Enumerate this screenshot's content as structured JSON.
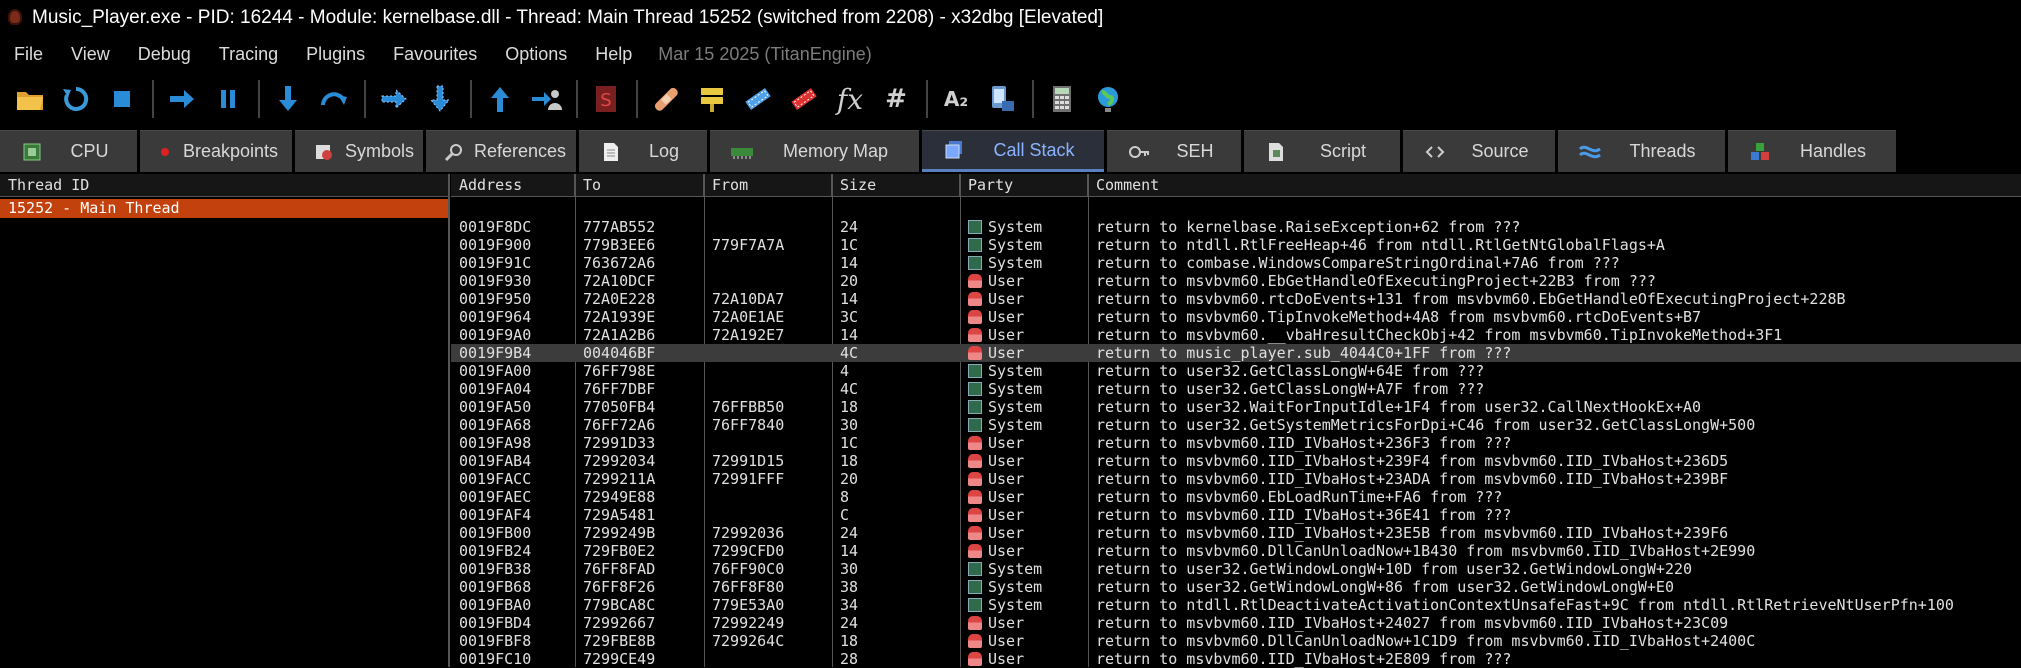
{
  "window": {
    "title": "Music_Player.exe - PID: 16244 - Module: kernelbase.dll - Thread: Main Thread 15252 (switched from 2208) - x32dbg [Elevated]"
  },
  "menu": {
    "items": [
      "File",
      "View",
      "Debug",
      "Tracing",
      "Plugins",
      "Favourites",
      "Options",
      "Help"
    ],
    "date_label": "Mar 15 2025 (TitanEngine)"
  },
  "toolbar": {
    "icons": [
      "open-icon",
      "restart-icon",
      "stop-icon",
      "run-icon",
      "pause-icon",
      "step-into-icon",
      "step-over-icon",
      "trace-into-icon",
      "trace-over-icon",
      "execute-till-return-icon",
      "run-to-user-code-icon",
      "scylla-icon",
      "patch-icon",
      "comments-icon",
      "labels-icon",
      "bookmarks-icon",
      "functions-icon",
      "variables-icon",
      "strings-icon",
      "device-icon",
      "calculator-icon",
      "globe-icon"
    ],
    "fx_label": "fx",
    "hash_label": "#",
    "a2_label": "A₂"
  },
  "tabs": [
    {
      "label": "CPU",
      "icon": "cpu-icon",
      "active": false
    },
    {
      "label": "Breakpoints",
      "icon": "breakpoint-dot-icon",
      "active": false
    },
    {
      "label": "Symbols",
      "icon": "symbols-icon",
      "active": false
    },
    {
      "label": "References",
      "icon": "magnifier-icon",
      "active": false
    },
    {
      "label": "Log",
      "icon": "log-icon",
      "active": false
    },
    {
      "label": "Memory Map",
      "icon": "memory-map-icon",
      "active": false
    },
    {
      "label": "Call Stack",
      "icon": "call-stack-icon",
      "active": true
    },
    {
      "label": "SEH",
      "icon": "seh-icon",
      "active": false
    },
    {
      "label": "Script",
      "icon": "script-icon",
      "active": false
    },
    {
      "label": "Source",
      "icon": "source-icon",
      "active": false
    },
    {
      "label": "Threads",
      "icon": "threads-icon",
      "active": false
    },
    {
      "label": "Handles",
      "icon": "handles-icon",
      "active": false
    }
  ],
  "threads_pane": {
    "header": "Thread ID",
    "items": [
      "15252 - Main Thread"
    ]
  },
  "callstack": {
    "headers": {
      "address": "Address",
      "to": "To",
      "from": "From",
      "size": "Size",
      "party": "Party",
      "comment": "Comment"
    },
    "rows": [
      {
        "address": "0019F8DC",
        "to": "777AB552",
        "from": "",
        "size": "24",
        "party": "System",
        "comment": "return to kernelbase.RaiseException+62 from ???"
      },
      {
        "address": "0019F900",
        "to": "779B3EE6",
        "from": "779F7A7A",
        "size": "1C",
        "party": "System",
        "comment": "return to ntdll.RtlFreeHeap+46 from ntdll.RtlGetNtGlobalFlags+A"
      },
      {
        "address": "0019F91C",
        "to": "763672A6",
        "from": "",
        "size": "14",
        "party": "System",
        "comment": "return to combase.WindowsCompareStringOrdinal+7A6 from ???"
      },
      {
        "address": "0019F930",
        "to": "72A10DCF",
        "from": "",
        "size": "20",
        "party": "User",
        "comment": "return to msvbvm60.EbGetHandleOfExecutingProject+22B3 from ???"
      },
      {
        "address": "0019F950",
        "to": "72A0E228",
        "from": "72A10DA7",
        "size": "14",
        "party": "User",
        "comment": "return to msvbvm60.rtcDoEvents+131 from msvbvm60.EbGetHandleOfExecutingProject+228B"
      },
      {
        "address": "0019F964",
        "to": "72A1939E",
        "from": "72A0E1AE",
        "size": "3C",
        "party": "User",
        "comment": "return to msvbvm60.TipInvokeMethod+4A8 from msvbvm60.rtcDoEvents+B7"
      },
      {
        "address": "0019F9A0",
        "to": "72A1A2B6",
        "from": "72A192E7",
        "size": "14",
        "party": "User",
        "comment": "return to msvbvm60.__vbaHresultCheckObj+42 from msvbvm60.TipInvokeMethod+3F1"
      },
      {
        "address": "0019F9B4",
        "to": "004046BF",
        "from": "",
        "size": "4C",
        "party": "User",
        "comment": "return to music_player.sub_4044C0+1FF from ???",
        "selected": true
      },
      {
        "address": "0019FA00",
        "to": "76FF798E",
        "from": "",
        "size": "4",
        "party": "System",
        "comment": "return to user32.GetClassLongW+64E from ???"
      },
      {
        "address": "0019FA04",
        "to": "76FF7DBF",
        "from": "",
        "size": "4C",
        "party": "System",
        "comment": "return to user32.GetClassLongW+A7F from ???"
      },
      {
        "address": "0019FA50",
        "to": "77050FB4",
        "from": "76FFBB50",
        "size": "18",
        "party": "System",
        "comment": "return to user32.WaitForInputIdle+1F4 from user32.CallNextHookEx+A0"
      },
      {
        "address": "0019FA68",
        "to": "76FF72A6",
        "from": "76FF7840",
        "size": "30",
        "party": "System",
        "comment": "return to user32.GetSystemMetricsForDpi+C46 from user32.GetClassLongW+500"
      },
      {
        "address": "0019FA98",
        "to": "72991D33",
        "from": "",
        "size": "1C",
        "party": "User",
        "comment": "return to msvbvm60.IID_IVbaHost+236F3 from ???"
      },
      {
        "address": "0019FAB4",
        "to": "72992034",
        "from": "72991D15",
        "size": "18",
        "party": "User",
        "comment": "return to msvbvm60.IID_IVbaHost+239F4 from msvbvm60.IID_IVbaHost+236D5"
      },
      {
        "address": "0019FACC",
        "to": "7299211A",
        "from": "72991FFF",
        "size": "20",
        "party": "User",
        "comment": "return to msvbvm60.IID_IVbaHost+23ADA from msvbvm60.IID_IVbaHost+239BF"
      },
      {
        "address": "0019FAEC",
        "to": "72949E88",
        "from": "",
        "size": "8",
        "party": "User",
        "comment": "return to msvbvm60.EbLoadRunTime+FA6 from ???"
      },
      {
        "address": "0019FAF4",
        "to": "729A5481",
        "from": "",
        "size": "C",
        "party": "User",
        "comment": "return to msvbvm60.IID_IVbaHost+36E41 from ???"
      },
      {
        "address": "0019FB00",
        "to": "7299249B",
        "from": "72992036",
        "size": "24",
        "party": "User",
        "comment": "return to msvbvm60.IID_IVbaHost+23E5B from msvbvm60.IID_IVbaHost+239F6"
      },
      {
        "address": "0019FB24",
        "to": "729FB0E2",
        "from": "7299CFD0",
        "size": "14",
        "party": "User",
        "comment": "return to msvbvm60.DllCanUnloadNow+1B430 from msvbvm60.IID_IVbaHost+2E990"
      },
      {
        "address": "0019FB38",
        "to": "76FF8FAD",
        "from": "76FF90C0",
        "size": "30",
        "party": "System",
        "comment": "return to user32.GetWindowLongW+10D from user32.GetWindowLongW+220"
      },
      {
        "address": "0019FB68",
        "to": "76FF8F26",
        "from": "76FF8F80",
        "size": "38",
        "party": "System",
        "comment": "return to user32.GetWindowLongW+86 from user32.GetWindowLongW+E0"
      },
      {
        "address": "0019FBA0",
        "to": "779BCA8C",
        "from": "779E53A0",
        "size": "34",
        "party": "System",
        "comment": "return to ntdll.RtlDeactivateActivationContextUnsafeFast+9C from ntdll.RtlRetrieveNtUserPfn+100"
      },
      {
        "address": "0019FBD4",
        "to": "72992667",
        "from": "72992249",
        "size": "24",
        "party": "User",
        "comment": "return to msvbvm60.IID_IVbaHost+24027 from msvbvm60.IID_IVbaHost+23C09"
      },
      {
        "address": "0019FBF8",
        "to": "729FBE8B",
        "from": "7299264C",
        "size": "18",
        "party": "User",
        "comment": "return to msvbvm60.DllCanUnloadNow+1C1D9 from msvbvm60.IID_IVbaHost+2400C"
      },
      {
        "address": "0019FC10",
        "to": "7299CE49",
        "from": "",
        "size": "28",
        "party": "User",
        "comment": "return to msvbvm60.IID_IVbaHost+2E809 from ???"
      }
    ]
  }
}
